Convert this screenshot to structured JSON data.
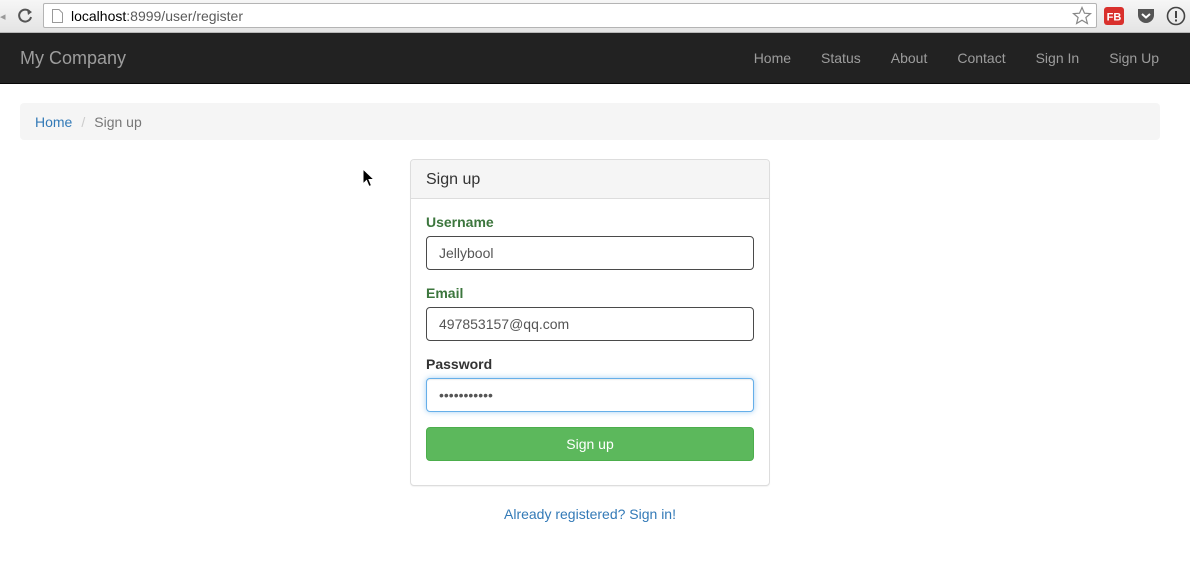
{
  "browser": {
    "url_host": "localhost",
    "url_rest": ":8999/user/register",
    "extension_fb_label": "FB"
  },
  "navbar": {
    "brand": "My Company",
    "links": [
      "Home",
      "Status",
      "About",
      "Contact",
      "Sign In",
      "Sign Up"
    ]
  },
  "breadcrumb": {
    "home": "Home",
    "separator": "/",
    "current": "Sign up"
  },
  "panel": {
    "title": "Sign up",
    "username": {
      "label": "Username",
      "value": "Jellybool"
    },
    "email": {
      "label": "Email",
      "value": "497853157@qq.com"
    },
    "password": {
      "label": "Password",
      "value": "•••••••••••"
    },
    "submit_label": "Sign up"
  },
  "signin_link": "Already registered? Sign in!",
  "colors": {
    "navbar_bg": "#222222",
    "nav_text": "#9d9d9d",
    "link": "#337ab7",
    "success_label": "#3c763d",
    "button_green": "#5cb85c"
  }
}
